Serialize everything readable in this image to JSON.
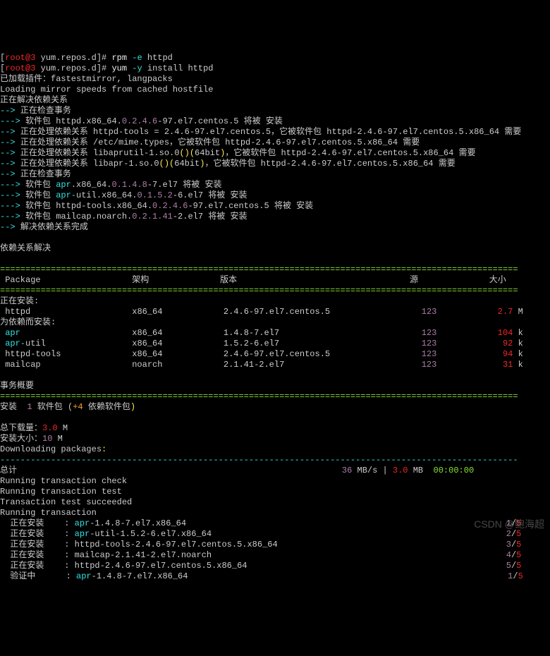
{
  "prompt": {
    "user_host": "root@3",
    "dir": "yum.repos.d",
    "cmd1_bin": "rpm",
    "cmd1_opt": "-e",
    "cmd1_arg": "httpd",
    "cmd2_bin": "yum",
    "cmd2_opt": "-y",
    "cmd2_arg": "install httpd"
  },
  "preamble": {
    "line1": "已加载插件：fastestmirror, langpacks",
    "line2": "Loading mirror speeds from cached hostfile",
    "line3": "正在解决依赖关系",
    "check": "正在检查事务"
  },
  "arrows": {
    "a1": "--> ",
    "a2": "---> "
  },
  "dep": {
    "pkg_prefix": "软件包 ",
    "process_prefix": "正在处理依赖关系 ",
    "httpd_pkg": "httpd",
    "httpd_arch": ".x86_64.",
    "httpd_ver1": "0.2.4.6",
    "httpd_rest1": "-97.el7.centos.5 将被 安装",
    "httpd_tools_eq": "httpd-tools = 2.4.6-97.el7.centos.5，它被软件包 httpd-2.4.6-97.el7.centos.5.x86_64 需要",
    "mime": "/etc/mime.types，它被软件包 httpd-2.4.6-97.el7.centos.5.x86_64 需要",
    "libaprutil_a": "libaprutil-1.so.0",
    "paren": "()(",
    "sixtyfour": "64bit",
    "close": ")",
    "needed_by": "，它被软件包 httpd-2.4.6-97.el7.centos.5.x86_64 需要",
    "libapr_a": "libapr-1.so.0",
    "apr_pkg": "apr",
    "apr_ver": "0.1.4.8",
    "apr_rest": "-7.el7 将被 安装",
    "aprutil_pkg": "apr-",
    "aprutil_name": "util.x86_64.",
    "aprutil_ver": "0.1.5.2",
    "aprutil_rest": "-6.el7 将被 安装",
    "httpdtools_name": "httpd-tools.x86_64.",
    "httpdtools_ver": "0.2.4.6",
    "httpdtools_rest": "-97.el7.centos.5 将被 安装",
    "mailcap_name": "mailcap.noarch.",
    "mailcap_ver": "0.2.1.41",
    "mailcap_rest": "-2.el7 将被 安装",
    "done": "解决依赖关系完成",
    "resolved": "依赖关系解决"
  },
  "table": {
    "hdr_pkg": " Package",
    "hdr_arch": "架构",
    "hdr_ver": "版本",
    "hdr_src": "源",
    "hdr_size": "大小",
    "installing": "正在安装:",
    "for_dep": "为依赖而安装:",
    "rows_main": [
      {
        "name": " httpd",
        "arch": "x86_64",
        "ver": "2.4.6-97.el7.centos.5",
        "src": "123",
        "size": "2.7",
        "unit": "M"
      }
    ],
    "rows_dep": [
      {
        "name": " apr",
        "arch": "x86_64",
        "ver": "1.4.8-7.el7",
        "src": "123",
        "size": "104",
        "unit": "k"
      },
      {
        "name": " apr-",
        "name2": "util",
        "arch": "x86_64",
        "ver": "1.5.2-6.el7",
        "src": "123",
        "size": "92",
        "unit": "k"
      },
      {
        "name": " httpd-tools",
        "arch": "x86_64",
        "ver": "2.4.6-97.el7.centos.5",
        "src": "123",
        "size": "94",
        "unit": "k"
      },
      {
        "name": " mailcap",
        "arch": "noarch",
        "ver": "2.1.41-2.el7",
        "src": "123",
        "size": "31",
        "unit": "k"
      }
    ]
  },
  "summary": {
    "title": "事务概要",
    "install_label": "安装  ",
    "one": "1",
    "pkg_word": " 软件包 (",
    "plus4": "+4",
    "dep_word": " 依赖软件包",
    "close": ")",
    "dl_label": "总下载量：",
    "dl_val": "3.0",
    "dl_unit": " M",
    "size_label": "安装大小：",
    "size_val": "10",
    "size_unit": " M",
    "downloading": "Downloading packages",
    "colon": ":"
  },
  "footer": {
    "dash": "------------------------------------------------------------------------------------------------------",
    "total": "总计",
    "speed": "36",
    "mbs": " MB/s | ",
    "tot": "3.0",
    "mb": " MB  ",
    "time": "00:00:00",
    "rtc": "Running transaction check",
    "rtt": "Running transaction test",
    "tts": "Transaction test succeeded",
    "rt": "Running transaction",
    "inst": "正在安装    : ",
    "verify": "验证中      : ",
    "rows": [
      {
        "pkg_c": "apr",
        "pkg_r": "-1.4.8-7.el7.x86_64",
        "n": "1",
        "d": "5"
      },
      {
        "pkg_c": "apr",
        "pkg_r": "-util-1.5.2-6.el7.x86_64",
        "n": "2",
        "d": "5"
      },
      {
        "pkg_r": "httpd-tools-2.4.6-97.el7.centos.5.x86_64",
        "n": "3",
        "d": "5"
      },
      {
        "pkg_r": "mailcap-2.1.41-2.el7.noarch",
        "n": "4",
        "d": "5"
      },
      {
        "pkg_r": "httpd-2.4.6-97.el7.centos.5.x86_64",
        "n": "5",
        "d": "5"
      }
    ],
    "vrows": [
      {
        "pkg_c": "apr",
        "pkg_r": "-1.4.8-7.el7.x86_64",
        "n": "1",
        "d": "5"
      }
    ]
  },
  "divider": "======================================================================================================",
  "watermark": "CSDN @鲍海超"
}
